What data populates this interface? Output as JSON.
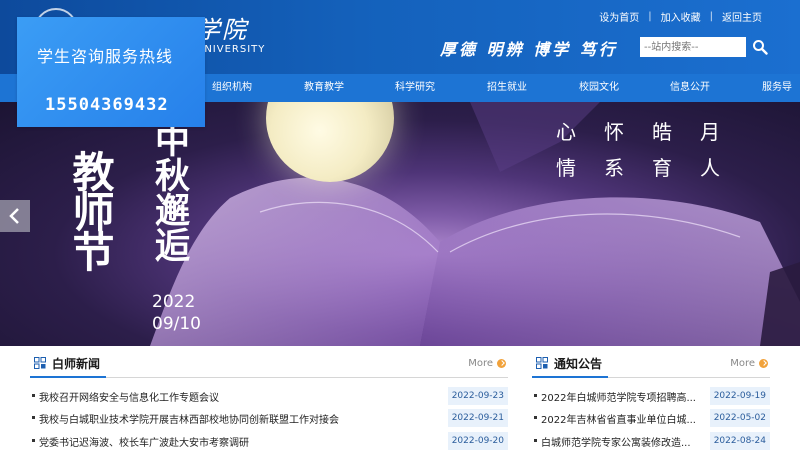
{
  "header": {
    "school_name": "白城师范学院",
    "school_name_visible": "学院",
    "school_en_visible": "UNIVERSITY",
    "top_links": [
      "设为首页",
      "加入收藏",
      "返回主页"
    ],
    "motto": "厚德 明辨 博学 笃行",
    "search": {
      "placeholder": "--站内搜索--"
    }
  },
  "hotline": {
    "title": "学生咨询服务热线",
    "phone": "15504369432"
  },
  "nav": {
    "items": [
      "组织机构",
      "教育教学",
      "科学研究",
      "招生就业",
      "校园文化",
      "信息公开",
      "服务导航"
    ]
  },
  "banner": {
    "slogan_line1": "心怀皓月",
    "slogan_line2": "情系育人",
    "title_big": "教师节",
    "title_mid": "中秋邂逅",
    "date_year": "2022",
    "date_day": "09/10"
  },
  "news": {
    "title": "白师新闻",
    "more": "More",
    "items": [
      {
        "text": "我校召开网络安全与信息化工作专题会议",
        "date": "2022-09-23"
      },
      {
        "text": "我校与白城职业技术学院开展吉林西部校地协同创新联盟工作对接会",
        "date": "2022-09-21"
      },
      {
        "text": "党委书记迟海波、校长车广波赴大安市考察调研",
        "date": "2022-09-20"
      }
    ]
  },
  "notice": {
    "title": "通知公告",
    "more": "More",
    "items": [
      {
        "text": "2022年白城师范学院专项招聘高...",
        "date": "2022-09-19"
      },
      {
        "text": "2022年吉林省省直事业单位白城...",
        "date": "2022-05-02"
      },
      {
        "text": "白城师范学院专家公寓装修改造...",
        "date": "2022-08-24"
      }
    ]
  },
  "colors": {
    "header_blue": "#1461bb",
    "nav_blue": "#1d74d4",
    "hotline_blue": "#2f8cf0",
    "more_orange": "#f1a23b"
  }
}
